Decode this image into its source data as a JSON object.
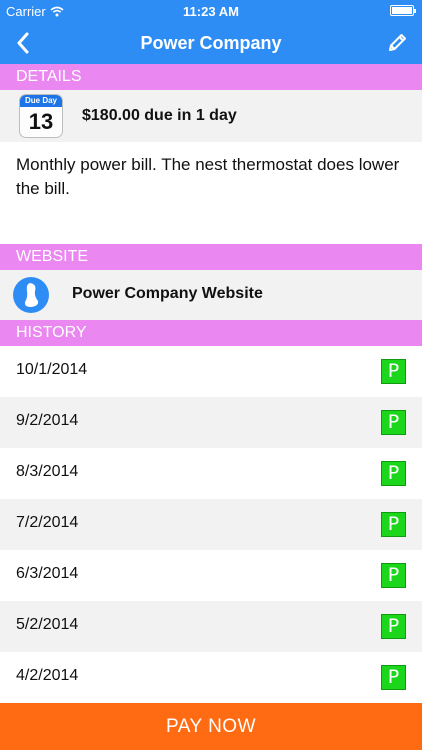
{
  "status_bar": {
    "carrier": "Carrier",
    "time": "11:23 AM"
  },
  "nav": {
    "title": "Power Company",
    "back_icon": "chevron-left-icon",
    "edit_icon": "pencil-icon"
  },
  "sections": {
    "details": "DETAILS",
    "website": "WEBSITE",
    "history": "HISTORY"
  },
  "details": {
    "calendar": {
      "label": "Due Day",
      "day": "13"
    },
    "due_text": "$180.00 due in 1 day",
    "notes": "Monthly power bill. The nest thermostat does lower the bill."
  },
  "website": {
    "label": "Power Company Website",
    "icon": "website-icon"
  },
  "history": [
    {
      "date": "10/1/2014",
      "badge": "P"
    },
    {
      "date": "9/2/2014",
      "badge": "P"
    },
    {
      "date": "8/3/2014",
      "badge": "P"
    },
    {
      "date": "7/2/2014",
      "badge": "P"
    },
    {
      "date": "6/3/2014",
      "badge": "P"
    },
    {
      "date": "5/2/2014",
      "badge": "P"
    },
    {
      "date": "4/2/2014",
      "badge": "P"
    }
  ],
  "pay_button": "PAY NOW",
  "colors": {
    "nav": "#2e8df5",
    "section": "#ea87f1",
    "paid": "#1bd61b",
    "pay": "#ff6b12"
  }
}
